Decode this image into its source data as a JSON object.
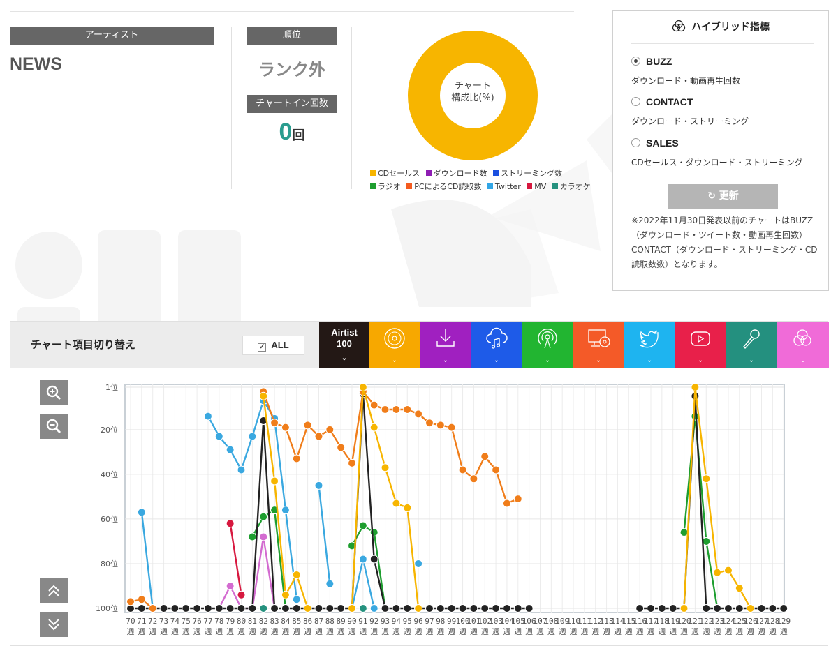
{
  "artist_section": {
    "label": "アーティスト",
    "name": "NEWS"
  },
  "rank_section": {
    "label": "順位",
    "value": "ランク外"
  },
  "chartin_section": {
    "label": "チャートイン回数",
    "count": "0",
    "unit": "回"
  },
  "composition": {
    "center_line1": "チャート",
    "center_line2": "構成比(%)",
    "donut_color": "#F7B500",
    "legend": [
      {
        "label": "CDセールス",
        "color": "#F7B500"
      },
      {
        "label": "ダウンロード数",
        "color": "#8E1DB3"
      },
      {
        "label": "ストリーミング数",
        "color": "#1A4FE0"
      },
      {
        "label": "ラジオ",
        "color": "#1E9E2F"
      },
      {
        "label": "PCによるCD読取数",
        "color": "#F45B1F"
      },
      {
        "label": "Twitter",
        "color": "#32A6E6"
      },
      {
        "label": "MV",
        "color": "#D7183F"
      },
      {
        "label": "カラオケ",
        "color": "#25917E"
      }
    ]
  },
  "hybrid": {
    "title": "ハイブリッド指標",
    "options": [
      {
        "name": "BUZZ",
        "desc": "ダウンロード・動画再生回数",
        "selected": true
      },
      {
        "name": "CONTACT",
        "desc": "ダウンロード・ストリーミング",
        "selected": false
      },
      {
        "name": "SALES",
        "desc": "CDセールス・ダウンロード・ストリーミング",
        "selected": false
      }
    ],
    "refresh_label": "更新",
    "note": "※2022年11月30日発表以前のチャートはBUZZ（ダウンロード・ツイート数・動画再生回数）CONTACT（ダウンロード・ストリーミング・CD読取数数）となります。"
  },
  "chart_controls": {
    "title": "チャート項目切り替え",
    "all_label": "ALL",
    "tabs": [
      {
        "name": "airtist-100",
        "line1": "Airtist",
        "line2": "100",
        "color": "#231815"
      },
      {
        "name": "cd-sales",
        "color": "#F7A800"
      },
      {
        "name": "download",
        "color": "#A020C0"
      },
      {
        "name": "streaming",
        "color": "#1E5BE8"
      },
      {
        "name": "radio",
        "color": "#22B531"
      },
      {
        "name": "pc-cd-read",
        "color": "#F45A28"
      },
      {
        "name": "twitter",
        "color": "#1EB4F0"
      },
      {
        "name": "youtube",
        "color": "#E8204A"
      },
      {
        "name": "karaoke",
        "color": "#24907F"
      },
      {
        "name": "hybrid",
        "color": "#F06BD8"
      }
    ],
    "icons": [
      "airtist-icon",
      "cd-icon",
      "download-icon",
      "cloud-music-icon",
      "radio-icon",
      "pc-cd-icon",
      "twitter-icon",
      "youtube-icon",
      "mic-icon",
      "hybrid-icon"
    ]
  },
  "chart_data": {
    "type": "line",
    "y_reversed": true,
    "ylim": [
      1,
      100
    ],
    "y_ticks": [
      1,
      20,
      40,
      60,
      80,
      100
    ],
    "y_tick_suffix": "位",
    "x_start": 70,
    "x_end": 129,
    "x_tick_suffix": "週",
    "series": [
      {
        "key": "airtist",
        "color": "#222222",
        "points": [
          [
            70,
            100
          ],
          [
            71,
            100
          ],
          [
            72,
            100
          ],
          [
            73,
            100
          ],
          [
            74,
            100
          ],
          [
            75,
            100
          ],
          [
            76,
            100
          ],
          [
            77,
            100
          ],
          [
            78,
            100
          ],
          [
            79,
            100
          ],
          [
            80,
            100
          ],
          [
            81,
            100
          ],
          [
            82,
            16
          ],
          [
            83,
            100
          ],
          [
            84,
            100
          ],
          [
            85,
            100
          ],
          [
            86,
            100
          ],
          [
            87,
            100
          ],
          [
            88,
            100
          ],
          [
            89,
            100
          ],
          [
            90,
            100
          ],
          [
            91,
            4
          ],
          [
            92,
            78
          ],
          [
            93,
            100
          ],
          [
            94,
            100
          ],
          [
            95,
            100
          ],
          [
            96,
            100
          ],
          [
            97,
            100
          ],
          [
            98,
            100
          ],
          [
            99,
            100
          ],
          [
            100,
            100
          ],
          [
            101,
            100
          ],
          [
            102,
            100
          ],
          [
            103,
            100
          ],
          [
            104,
            100
          ],
          [
            105,
            100
          ],
          [
            106,
            100
          ]
        ],
        "points2": [
          [
            116,
            100
          ],
          [
            117,
            100
          ],
          [
            118,
            100
          ],
          [
            119,
            100
          ],
          [
            120,
            100
          ],
          [
            121,
            5
          ],
          [
            122,
            100
          ],
          [
            123,
            100
          ],
          [
            124,
            100
          ],
          [
            125,
            100
          ],
          [
            126,
            100
          ],
          [
            127,
            100
          ],
          [
            128,
            100
          ],
          [
            129,
            100
          ]
        ]
      },
      {
        "key": "cd",
        "color": "#F7B500",
        "points": [
          [
            82,
            5
          ],
          [
            83,
            43
          ],
          [
            84,
            94
          ],
          [
            85,
            85
          ],
          [
            86,
            100
          ]
        ],
        "points2": [
          [
            90,
            100
          ],
          [
            91,
            1
          ],
          [
            92,
            19
          ],
          [
            93,
            37
          ],
          [
            94,
            53
          ],
          [
            95,
            55
          ],
          [
            96,
            100
          ]
        ],
        "points3": [
          [
            120,
            100
          ],
          [
            121,
            1
          ],
          [
            122,
            42
          ],
          [
            123,
            84
          ],
          [
            124,
            83
          ],
          [
            125,
            91
          ],
          [
            126,
            100
          ]
        ]
      },
      {
        "key": "pc",
        "color": "#F07D1A",
        "points": [
          [
            70,
            97
          ],
          [
            71,
            96
          ],
          [
            72,
            100
          ]
        ],
        "points2": [
          [
            82,
            3
          ],
          [
            83,
            17
          ],
          [
            84,
            19
          ],
          [
            85,
            33
          ],
          [
            86,
            18
          ],
          [
            87,
            23
          ],
          [
            88,
            20
          ],
          [
            89,
            28
          ],
          [
            90,
            35
          ],
          [
            91,
            3
          ],
          [
            92,
            9
          ],
          [
            93,
            11
          ],
          [
            94,
            11
          ],
          [
            95,
            11
          ],
          [
            96,
            13
          ],
          [
            97,
            17
          ],
          [
            98,
            18
          ],
          [
            99,
            19
          ],
          [
            100,
            38
          ],
          [
            101,
            42
          ],
          [
            102,
            32
          ],
          [
            103,
            38
          ],
          [
            104,
            53
          ],
          [
            105,
            51
          ]
        ]
      },
      {
        "key": "twitter",
        "color": "#3AA8E0",
        "points": [
          [
            71,
            57
          ],
          [
            72,
            100
          ]
        ],
        "points2": [
          [
            77,
            14
          ],
          [
            78,
            23
          ],
          [
            79,
            29
          ],
          [
            80,
            38
          ],
          [
            81,
            23
          ],
          [
            82,
            7
          ],
          [
            83,
            15
          ],
          [
            84,
            56
          ],
          [
            85,
            96
          ]
        ],
        "points3": [
          [
            87,
            45
          ],
          [
            88,
            89
          ]
        ],
        "points4": [
          [
            90,
            100
          ],
          [
            91,
            78
          ],
          [
            92,
            100
          ]
        ],
        "points5": [
          [
            96,
            80
          ]
        ]
      },
      {
        "key": "radio",
        "color": "#1E9E2F",
        "points": [
          [
            81,
            68
          ],
          [
            82,
            59
          ],
          [
            83,
            56
          ],
          [
            84,
            100
          ]
        ],
        "points2": [
          [
            90,
            72
          ],
          [
            91,
            63
          ],
          [
            92,
            66
          ],
          [
            93,
            100
          ]
        ],
        "points3": [
          [
            120,
            66
          ],
          [
            121,
            14
          ],
          [
            122,
            70
          ],
          [
            123,
            100
          ]
        ]
      },
      {
        "key": "mv",
        "color": "#D7183F",
        "points": [
          [
            79,
            62
          ],
          [
            80,
            94
          ]
        ]
      },
      {
        "key": "download",
        "color": "#D36BD0",
        "points": [
          [
            78,
            100
          ],
          [
            79,
            90
          ],
          [
            80,
            100
          ],
          [
            81,
            100
          ],
          [
            82,
            68
          ],
          [
            83,
            100
          ]
        ]
      },
      {
        "key": "karaoke",
        "color": "#25917E",
        "points": [
          [
            82,
            100
          ],
          [
            91,
            100
          ]
        ]
      }
    ]
  }
}
